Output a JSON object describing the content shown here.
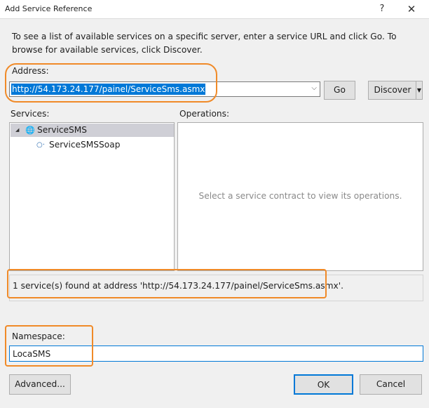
{
  "window": {
    "title": "Add Service Reference",
    "help_label": "?",
    "close_label": "✕"
  },
  "intro_text": "To see a list of available services on a specific server, enter a service URL and click Go. To browse for available services, click Discover.",
  "address": {
    "label": "Address:",
    "value": "http://54.173.24.177/painel/ServiceSms.asmx",
    "dropdown_icon": "chevron-down-icon"
  },
  "buttons": {
    "go": "Go",
    "discover": "Discover",
    "advanced": "Advanced...",
    "ok": "OK",
    "cancel": "Cancel"
  },
  "services": {
    "label": "Services:",
    "tree": [
      {
        "label": "ServiceSMS",
        "icon": "globe-icon",
        "expanded": true,
        "selected": true
      },
      {
        "label": "ServiceSMSSoap",
        "icon": "interface-icon",
        "selected": false
      }
    ]
  },
  "operations": {
    "label": "Operations:",
    "empty_message": "Select a service contract to view its operations."
  },
  "status_message": "1 service(s) found at address 'http://54.173.24.177/painel/ServiceSms.asmx'.",
  "namespace": {
    "label": "Namespace:",
    "value": "LocaSMS"
  },
  "colors": {
    "accent": "#0078d7",
    "highlight_annotation": "#f08a28",
    "selection_bg": "#cfcfd6"
  }
}
